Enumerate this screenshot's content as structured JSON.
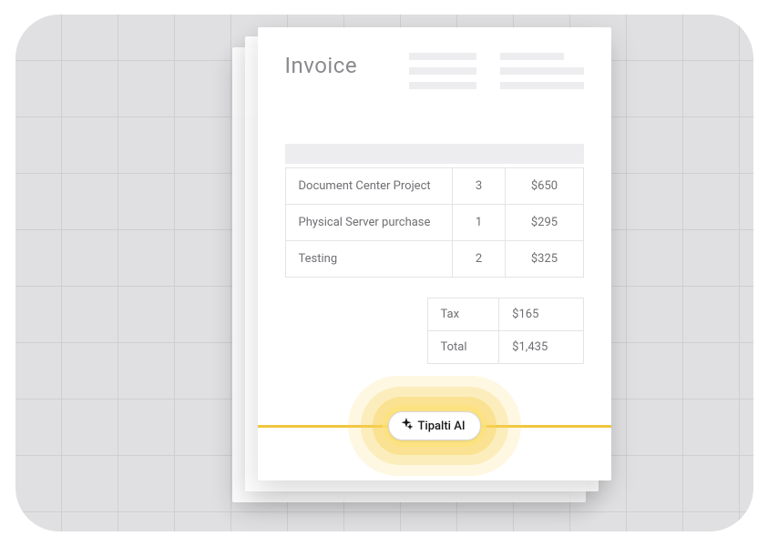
{
  "title": "Invoice",
  "items": [
    {
      "desc": "Document Center Project",
      "qty": "3",
      "price": "$650"
    },
    {
      "desc": "Physical Server purchase",
      "qty": "1",
      "price": "$295"
    },
    {
      "desc": "Testing",
      "qty": "2",
      "price": "$325"
    }
  ],
  "summary": {
    "tax_label": "Tax",
    "tax_value": "$165",
    "total_label": "Total",
    "total_value": "$1,435"
  },
  "ai": {
    "label": "Tipalti AI"
  }
}
